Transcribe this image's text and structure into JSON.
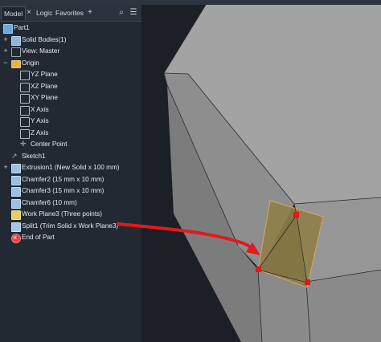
{
  "panel": {
    "tabs": [
      {
        "label": "Model"
      },
      {
        "label": "Logic"
      },
      {
        "label": "Favorites"
      }
    ],
    "close_glyph": "×",
    "add_glyph": "+",
    "search_glyph": "⌕",
    "menu_glyph": "☰"
  },
  "tree": {
    "items": [
      {
        "label": "Part1",
        "icon": "part-icon",
        "expander": ""
      },
      {
        "label": "Solid Bodies(1)",
        "icon": "solid-bodies-icon",
        "expander": "+"
      },
      {
        "label": "View: Master",
        "icon": "view-icon",
        "expander": "+"
      },
      {
        "label": "Origin",
        "icon": "folder-icon",
        "expander": "−"
      },
      {
        "label": "YZ Plane",
        "icon": "plane-icon",
        "expander": ""
      },
      {
        "label": "XZ Plane",
        "icon": "plane-icon",
        "expander": ""
      },
      {
        "label": "XY Plane",
        "icon": "plane-icon",
        "expander": ""
      },
      {
        "label": "X Axis",
        "icon": "axis-icon",
        "expander": ""
      },
      {
        "label": "Y Axis",
        "icon": "axis-icon",
        "expander": ""
      },
      {
        "label": "Z Axis",
        "icon": "axis-icon",
        "expander": ""
      },
      {
        "label": "Center Point",
        "icon": "point-icon",
        "expander": ""
      },
      {
        "label": "Sketch1",
        "icon": "sketch-icon",
        "expander": ""
      },
      {
        "label": "Extrusion1 (New Solid x 100 mm)",
        "icon": "extrusion-icon",
        "expander": "+"
      },
      {
        "label": "Chamfer2 (15 mm x 10 mm)",
        "icon": "chamfer-icon",
        "expander": ""
      },
      {
        "label": "Chamfer3 (15 mm x 10 mm)",
        "icon": "chamfer-icon",
        "expander": ""
      },
      {
        "label": "Chamfer6 (10 mm)",
        "icon": "chamfer-icon",
        "expander": ""
      },
      {
        "label": "Work Plane3 (Three points)",
        "icon": "work-plane-icon",
        "expander": ""
      },
      {
        "label": "Split1 (Trim Solid x Work Plane3)",
        "icon": "split-icon",
        "expander": ""
      },
      {
        "label": "End of Part",
        "icon": "end-of-part-icon",
        "expander": ""
      }
    ]
  },
  "colors": {
    "panel_bg": "#222933",
    "model_face": "#9a9a9a",
    "work_plane": "#8f8048",
    "annotation_arrow": "#e21a1a",
    "point_marker": "#e01818"
  }
}
